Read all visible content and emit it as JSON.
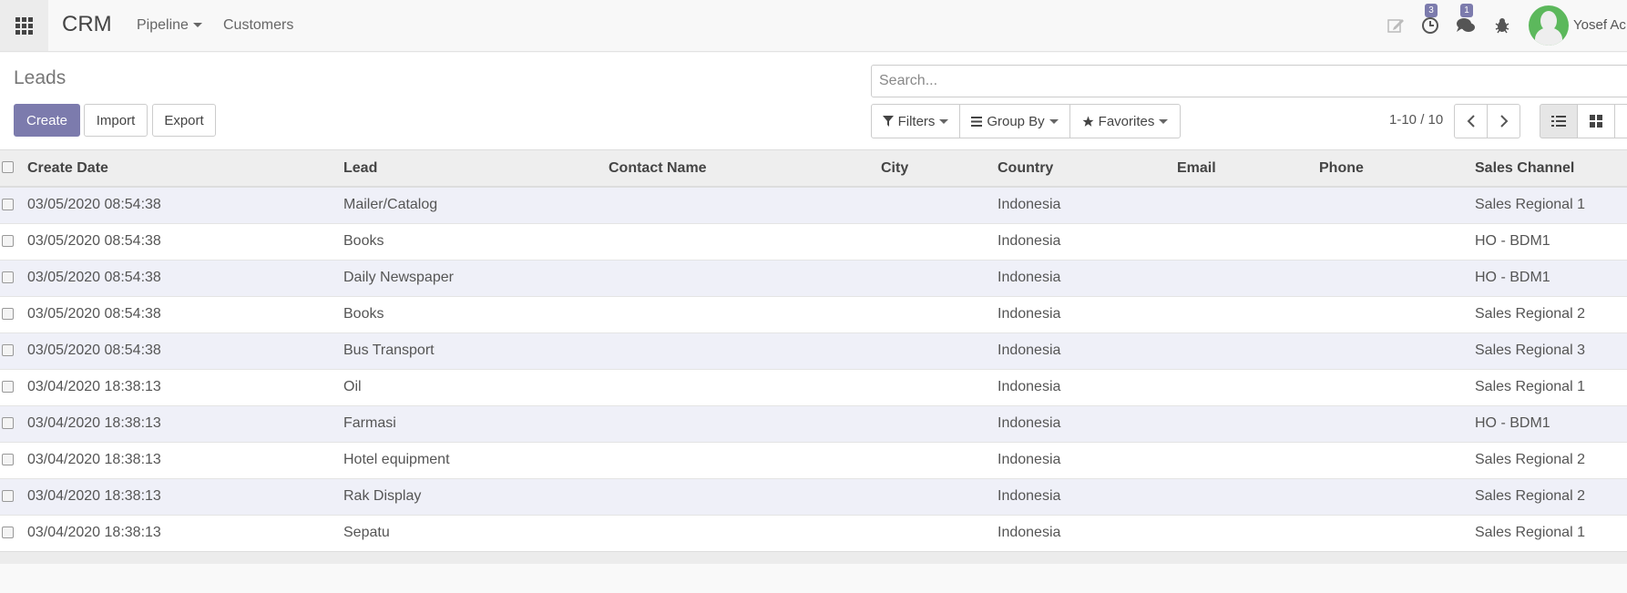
{
  "navbar": {
    "brand": "CRM",
    "menu": [
      {
        "label": "Pipeline",
        "has_dropdown": true
      },
      {
        "label": "Customers",
        "has_dropdown": false
      }
    ],
    "activity_badge": "3",
    "messages_badge": "1",
    "user_name": "Yosef Ac",
    "accent_color": "#7c7bad"
  },
  "control_panel": {
    "breadcrumb": "Leads",
    "create_label": "Create",
    "import_label": "Import",
    "export_label": "Export",
    "search_placeholder": "Search...",
    "filters_label": "Filters",
    "groupby_label": "Group By",
    "favorites_label": "Favorites",
    "pager": "1-10 / 10"
  },
  "table": {
    "columns": [
      "Create Date",
      "Lead",
      "Contact Name",
      "City",
      "Country",
      "Email",
      "Phone",
      "Sales Channel"
    ],
    "rows": [
      {
        "date": "03/05/2020 08:54:38",
        "lead": "Mailer/Catalog",
        "contact": "",
        "city": "",
        "country": "Indonesia",
        "email": "",
        "phone": "",
        "channel": "Sales Regional 1"
      },
      {
        "date": "03/05/2020 08:54:38",
        "lead": "Books",
        "contact": "",
        "city": "",
        "country": "Indonesia",
        "email": "",
        "phone": "",
        "channel": "HO - BDM1"
      },
      {
        "date": "03/05/2020 08:54:38",
        "lead": "Daily Newspaper",
        "contact": "",
        "city": "",
        "country": "Indonesia",
        "email": "",
        "phone": "",
        "channel": "HO - BDM1"
      },
      {
        "date": "03/05/2020 08:54:38",
        "lead": "Books",
        "contact": "",
        "city": "",
        "country": "Indonesia",
        "email": "",
        "phone": "",
        "channel": "Sales Regional 2"
      },
      {
        "date": "03/05/2020 08:54:38",
        "lead": "Bus Transport",
        "contact": "",
        "city": "",
        "country": "Indonesia",
        "email": "",
        "phone": "",
        "channel": "Sales Regional 3"
      },
      {
        "date": "03/04/2020 18:38:13",
        "lead": "Oil",
        "contact": "",
        "city": "",
        "country": "Indonesia",
        "email": "",
        "phone": "",
        "channel": "Sales Regional 1"
      },
      {
        "date": "03/04/2020 18:38:13",
        "lead": "Farmasi",
        "contact": "",
        "city": "",
        "country": "Indonesia",
        "email": "",
        "phone": "",
        "channel": "HO - BDM1"
      },
      {
        "date": "03/04/2020 18:38:13",
        "lead": "Hotel equipment",
        "contact": "",
        "city": "",
        "country": "Indonesia",
        "email": "",
        "phone": "",
        "channel": "Sales Regional 2"
      },
      {
        "date": "03/04/2020 18:38:13",
        "lead": "Rak Display",
        "contact": "",
        "city": "",
        "country": "Indonesia",
        "email": "",
        "phone": "",
        "channel": "Sales Regional 2"
      },
      {
        "date": "03/04/2020 18:38:13",
        "lead": "Sepatu",
        "contact": "",
        "city": "",
        "country": "Indonesia",
        "email": "",
        "phone": "",
        "channel": "Sales Regional 1"
      }
    ]
  }
}
